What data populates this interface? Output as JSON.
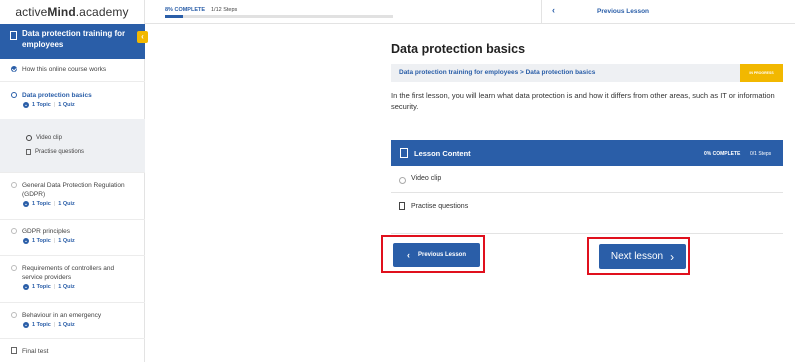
{
  "brand": {
    "prefix": "active",
    "bold": "Mind",
    "suffix": ".academy"
  },
  "sidebar": {
    "course_title": "Data protection training for employees",
    "items": [
      {
        "label": "How this online course works"
      },
      {
        "label": "Data protection basics",
        "topics": "1 Topic",
        "quizzes": "1 Quiz"
      },
      {
        "label": "General Data Protection Regulation (GDPR)",
        "topics": "1 Topic",
        "quizzes": "1 Quiz"
      },
      {
        "label": "GDPR principles",
        "topics": "1 Topic",
        "quizzes": "1 Quiz"
      },
      {
        "label": "Requirements of controllers and service providers",
        "topics": "1 Topic",
        "quizzes": "1 Quiz"
      },
      {
        "label": "Behaviour in an emergency",
        "topics": "1 Topic",
        "quizzes": "1 Quiz"
      },
      {
        "label": "Final test"
      }
    ],
    "sub_items": [
      {
        "label": "Video clip"
      },
      {
        "label": "Practise questions"
      }
    ]
  },
  "topbar": {
    "progress_label": "8% COMPLETE",
    "progress_fraction": 0.08,
    "steps_label": "1/12 Steps",
    "prev_label": "Previous Lesson"
  },
  "main": {
    "title": "Data protection basics",
    "breadcrumb": "Data protection training for employees > Data protection basics",
    "badge": "IN PROGRESS",
    "intro": "In the first lesson, you will learn what data protection is and how it differs from other areas, such as IT or information security.",
    "lesson_content": {
      "header": "Lesson Content",
      "complete": "0% COMPLETE",
      "steps": "0/1 Steps",
      "items": [
        {
          "label": "Video clip"
        },
        {
          "label": "Practise questions"
        }
      ]
    },
    "prev_button": "Previous Lesson",
    "next_button": "Next lesson"
  },
  "colors": {
    "primary": "#2a5ea8",
    "accent": "#f2b800",
    "highlight": "#e0101d"
  }
}
